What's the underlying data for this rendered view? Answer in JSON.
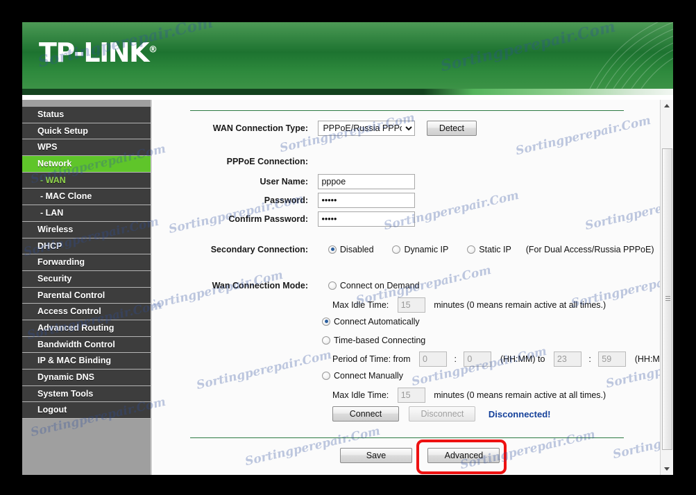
{
  "window": {
    "brand": "TP-LINK",
    "brand_mark": "®"
  },
  "sidebar": {
    "items": [
      {
        "label": "Status",
        "state": "normal"
      },
      {
        "label": "Quick Setup",
        "state": "normal"
      },
      {
        "label": "WPS",
        "state": "normal"
      },
      {
        "label": "Network",
        "state": "active"
      },
      {
        "label": "- WAN",
        "state": "sub"
      },
      {
        "label": "- MAC Clone",
        "state": "sub-plain"
      },
      {
        "label": "- LAN",
        "state": "sub-plain"
      },
      {
        "label": "Wireless",
        "state": "normal"
      },
      {
        "label": "DHCP",
        "state": "normal"
      },
      {
        "label": "Forwarding",
        "state": "normal"
      },
      {
        "label": "Security",
        "state": "normal"
      },
      {
        "label": "Parental Control",
        "state": "normal"
      },
      {
        "label": "Access Control",
        "state": "normal"
      },
      {
        "label": "Advanced Routing",
        "state": "normal"
      },
      {
        "label": "Bandwidth Control",
        "state": "normal"
      },
      {
        "label": "IP & MAC Binding",
        "state": "normal"
      },
      {
        "label": "Dynamic DNS",
        "state": "normal"
      },
      {
        "label": "System Tools",
        "state": "normal"
      },
      {
        "label": "Logout",
        "state": "normal"
      }
    ]
  },
  "form": {
    "wan_type_label": "WAN Connection Type:",
    "wan_type_value": "PPPoE/Russia PPPoE",
    "wan_type_options": [
      "PPPoE/Russia PPPoE"
    ],
    "detect_button": "Detect",
    "pppoe_section_label": "PPPoE Connection:",
    "username_label": "User Name:",
    "username_value": "pppoe",
    "password_label": "Password:",
    "password_value": "•••••",
    "confirm_password_label": "Confirm Password:",
    "confirm_password_value": "•••••",
    "secondary_label": "Secondary Connection:",
    "secondary_options": [
      {
        "label": "Disabled",
        "selected": true
      },
      {
        "label": "Dynamic IP",
        "selected": false
      },
      {
        "label": "Static IP",
        "selected": false
      }
    ],
    "secondary_note": "(For Dual Access/Russia PPPoE)",
    "mode_label": "Wan Connection Mode:",
    "mode_connect_on_demand": "Connect on Demand",
    "mode_connect_automatically": "Connect Automatically",
    "mode_time_based": "Time-based Connecting",
    "mode_connect_manually": "Connect Manually",
    "selected_mode": "Connect Automatically",
    "max_idle_label": "Max Idle Time:",
    "max_idle_value_1": "15",
    "max_idle_value_2": "15",
    "minutes_note": "minutes (0 means remain active at all times.)",
    "period_label": "Period of Time: from",
    "period_from_hh": "0",
    "period_from_mm": "0",
    "period_to_label": "(HH:MM) to",
    "period_to_hh": "23",
    "period_to_mm": "59",
    "period_end_label": "(HH:MM)",
    "colon": ":",
    "connect_button": "Connect",
    "disconnect_button": "Disconnect",
    "connection_status": "Disconnected!",
    "save_button": "Save",
    "advanced_button": "Advanced"
  },
  "watermark": {
    "text": "Sortingperepair.Com"
  }
}
